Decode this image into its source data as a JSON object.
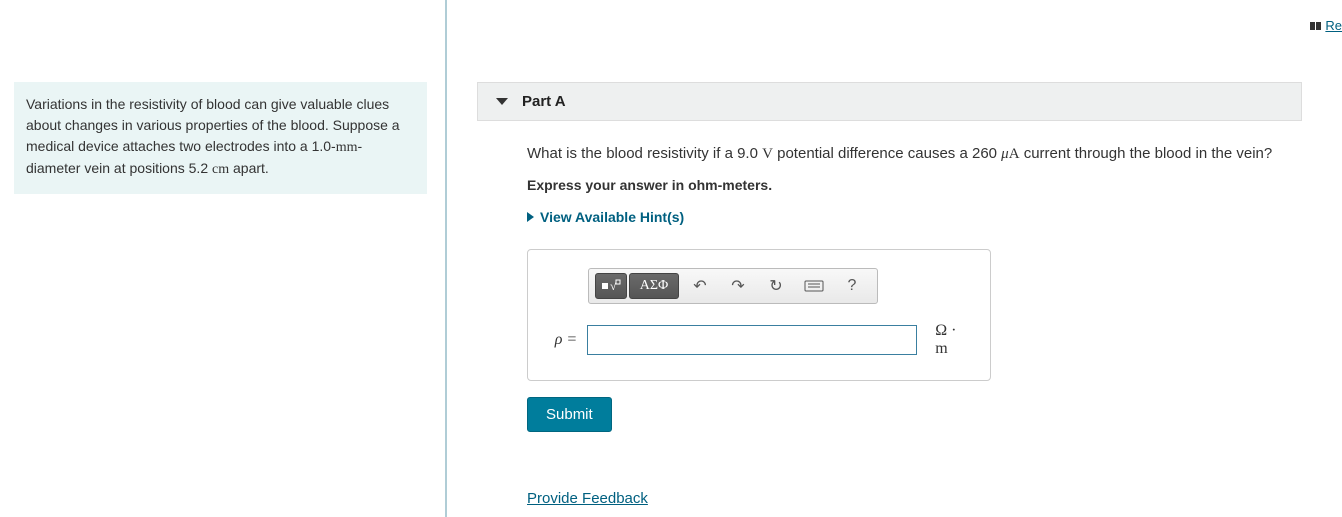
{
  "top_link": {
    "label": "Re"
  },
  "problem": {
    "text_html": "Variations in the resistivity of blood can give valuable clues about changes in various properties of the blood. Suppose a medical device attaches two electrodes into a 1.0-mm-diameter vein at positions 5.2 cm apart."
  },
  "part": {
    "title": "Part A",
    "question_html": "What is the blood resistivity if a 9.0 V potential difference causes a 260 μA current through the blood in the vein?",
    "instruction": "Express your answer in ohm-meters.",
    "hints_label": "View Available Hint(s)",
    "toolbar": {
      "template": "▫√▫",
      "greek": "ΑΣΦ",
      "undo": "↶",
      "redo": "↷",
      "reset": "↻",
      "keyboard": "kbd",
      "help": "?"
    },
    "var": "ρ =",
    "unit": "Ω · m",
    "submit": "Submit"
  },
  "feedback": "Provide Feedback"
}
